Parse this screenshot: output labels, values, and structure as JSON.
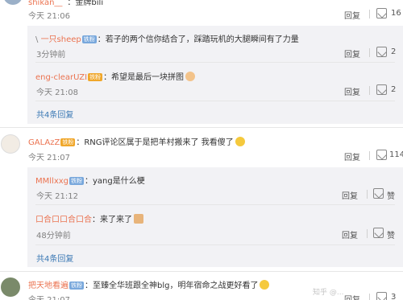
{
  "c0": {
    "username": "shikan__",
    "suffix": "：",
    "text": "金牌bili",
    "time": "今天 21:06",
    "reply": "回复",
    "likes": "16"
  },
  "r1": {
    "prefix": "\\",
    "username": "一只sheep",
    "badge": "铁粉",
    "text": "：若子的两个信你结合了，踩踏玩机的大腿瞬间有了力量",
    "time": "3分钟前",
    "reply": "回复",
    "likes": "2"
  },
  "r2": {
    "username": "eng-clearUZI",
    "badge": "铁粉",
    "text": "：希望是最后一块拼图",
    "time": "今天 21:08",
    "reply": "回复",
    "likes": "2"
  },
  "more1": "共4条回复",
  "c1": {
    "username": "GALAzZ",
    "badge": "铁粉",
    "text": "：RNG评论区属于是把羊村搬来了 我看傻了",
    "time": "今天 21:07",
    "reply": "回复",
    "likes": "114"
  },
  "r3": {
    "username": "MMllxxg",
    "badge": "铁粉",
    "text": "：yang是什么梗",
    "time": "今天 21:12",
    "reply": "回复",
    "likes": "赞"
  },
  "r4": {
    "username": "口合口口合口合",
    "text": "：来了来了",
    "time": "48分钟前",
    "reply": "回复",
    "likes": "赞"
  },
  "more2": "共4条回复",
  "c2": {
    "username": "把天地看遍",
    "badge": "铁粉",
    "text": "：至臻全华班跟全神blg，明年宿命之战更好看了",
    "time": "今天 21:07",
    "reply": "回复",
    "likes": "3"
  },
  "watermark": "知乎 @..."
}
